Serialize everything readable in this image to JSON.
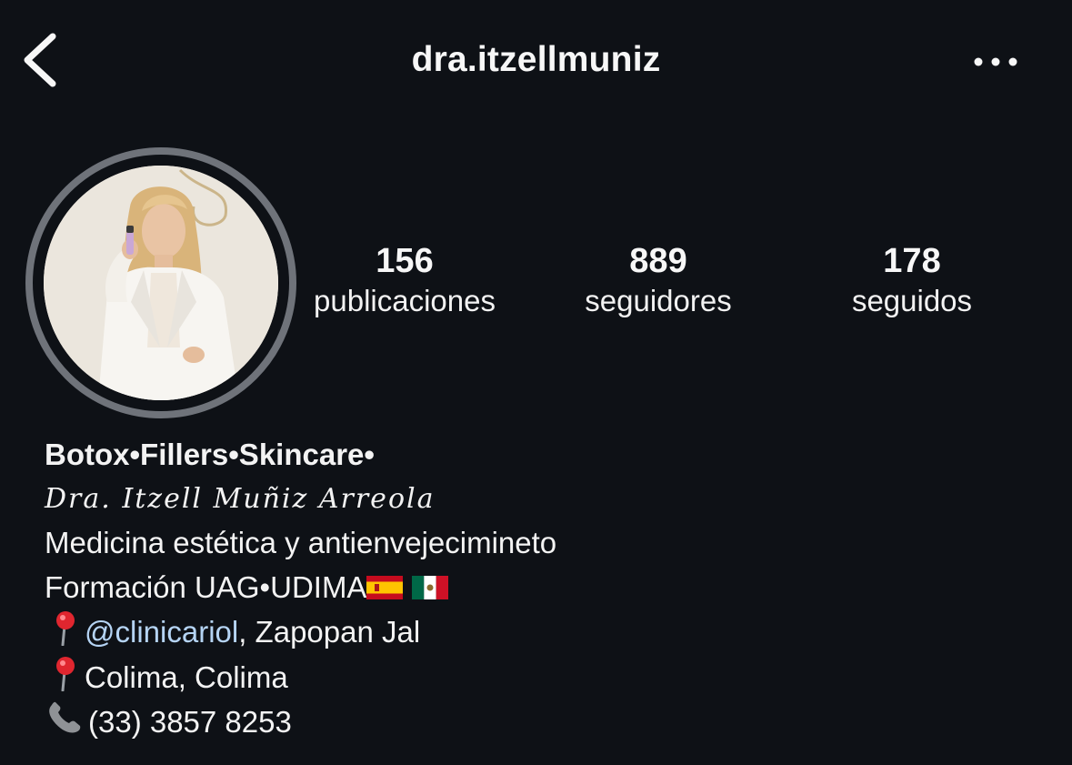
{
  "header": {
    "username": "dra.itzellmuniz"
  },
  "stats": [
    {
      "value": "156",
      "label": "publicaciones"
    },
    {
      "value": "889",
      "label": "seguidores"
    },
    {
      "value": "178",
      "label": "seguidos"
    }
  ],
  "bio": {
    "category": "Botox•Fillers•Skincare•",
    "name": "Dra. Itzell Muñiz Arreola",
    "line1": "Medicina estética y antienvejecimineto",
    "line2": "Formación UAG•UDIMA",
    "location1_mention": "@clinicariol",
    "location1_rest": ", Zapopan Jal",
    "location2": "Colima, Colima",
    "phone": "(33) 3857 8253"
  },
  "icons": {
    "back": "chevron-left-icon",
    "more": "more-horizontal-icon",
    "pin": "round-pushpin-icon",
    "phone": "telephone-receiver-icon",
    "flag_spain": "flag-spain-icon",
    "flag_mexico": "flag-mexico-icon"
  },
  "colors": {
    "background": "#0e1116",
    "text": "#f5f5f5",
    "link": "#b5d4f4",
    "avatar_ring": "#6f737a"
  }
}
